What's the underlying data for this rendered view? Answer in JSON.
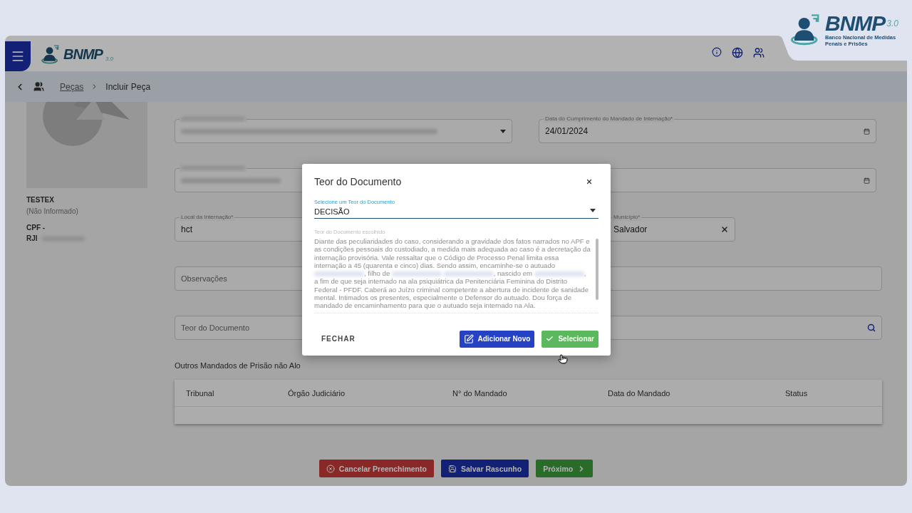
{
  "corner_logo": {
    "name": "BNMP",
    "version": "3.0",
    "subtitle": "Banco Nacional de Medidas Penais e Prisões"
  },
  "header": {
    "logo": {
      "name": "BNMP",
      "version": "3.0"
    }
  },
  "breadcrumb": [
    {
      "label": "Peças",
      "kind": "link"
    },
    {
      "label": "Incluir Peça",
      "kind": "current"
    }
  ],
  "person": {
    "name": "TESTEX",
    "note": "(Não Informado)",
    "cpf": "CPF -",
    "rji": "RJI"
  },
  "form": {
    "mandate_field": {
      "kind": "select",
      "redacted_label": true,
      "redacted_value": true
    },
    "date_field": {
      "kind": "date",
      "label": "Data do Cumprimento do Mandado de Internação*",
      "value": "24/01/2024"
    },
    "process_field": {
      "redacted_label": true,
      "redacted_value": true
    },
    "second_date_field": {
      "kind": "date"
    },
    "location_field": {
      "label": "Local da Internação*",
      "value": "hct"
    },
    "municipality_field": {
      "kind": "clearable",
      "label": "Município*",
      "value": "Salvador"
    },
    "observations_field": {
      "placeholder": "Observações"
    },
    "document_field": {
      "kind": "search",
      "placeholder": "Teor do Documento"
    }
  },
  "other_warrants": {
    "title": "Outros Mandados de Prisão não Alo",
    "columns": [
      "Tribunal",
      "Órgão Judiciário",
      "N° do Mandado",
      "Data do Mandado",
      "Status"
    ]
  },
  "actions": [
    {
      "label": "Cancelar Preenchimento",
      "kind": "cancel"
    },
    {
      "label": "Salvar Rascunho",
      "kind": "save"
    },
    {
      "label": "Próximo",
      "kind": "next"
    }
  ],
  "modal": {
    "title": "Teor do Documento",
    "select_label": "Selecione um Teor do Documento",
    "select_value": "DECISÃO",
    "text_label": "Teor do Documento escolhido",
    "text_parts": [
      {
        "kind": "text",
        "text": "Diante das peculiaridades do caso, considerando a gravidade dos fatos narrados no APF e as condições pessoais do custodiado, a medida mais adequada ao caso é a decretação da internação provisória. Vale ressaltar que o Código de Processo Penal limita essa internação a 45 (quarenta e cinco) dias. Sendo assim, encaminhe-se o autuado"
      },
      {
        "kind": "redacted"
      },
      {
        "kind": "text",
        "text": ", filho de"
      },
      {
        "kind": "redacted"
      },
      {
        "kind": "redacted"
      },
      {
        "kind": "text",
        "text": ", nascido em"
      },
      {
        "kind": "redacted"
      },
      {
        "kind": "text",
        "text": ", a fim de que seja internado na ala psiquiátrica da Penitenciária Feminina do Distrito Federal - PFDF. Caberá ao Juízo criminal competente a abertura de incidente de sanidade mental. Intimados os presentes, especialmente o Defensor do autuado. Dou força de mandado de encaminhamento para que o autuado seja internado na Ala."
      }
    ],
    "buttons": [
      {
        "label": "FECHAR",
        "kind": "close"
      },
      {
        "label": "Adicionar Novo",
        "kind": "add"
      },
      {
        "label": "Selecionar",
        "kind": "select"
      }
    ]
  }
}
